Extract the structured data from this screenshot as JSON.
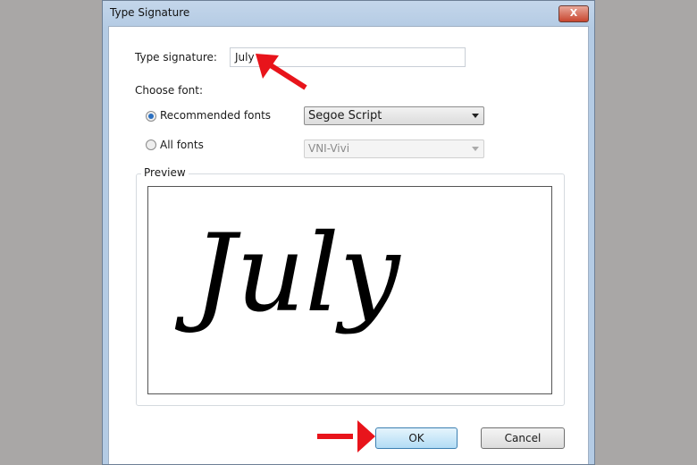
{
  "window": {
    "title": "Type Signature",
    "close_label": "X"
  },
  "form": {
    "type_signature_label": "Type signature:",
    "type_signature_value": "July",
    "choose_font_label": "Choose font:",
    "recommended_label": "Recommended fonts",
    "recommended_selected": true,
    "recommended_value": "Segoe Script",
    "all_fonts_label": "All fonts",
    "all_fonts_value": "VNI-Vivi",
    "preview_label": "Preview",
    "preview_text": "July"
  },
  "buttons": {
    "ok": "OK",
    "cancel": "Cancel"
  },
  "colors": {
    "annotation_arrow": "#e8141b",
    "default_button": "#b2dcf5"
  }
}
